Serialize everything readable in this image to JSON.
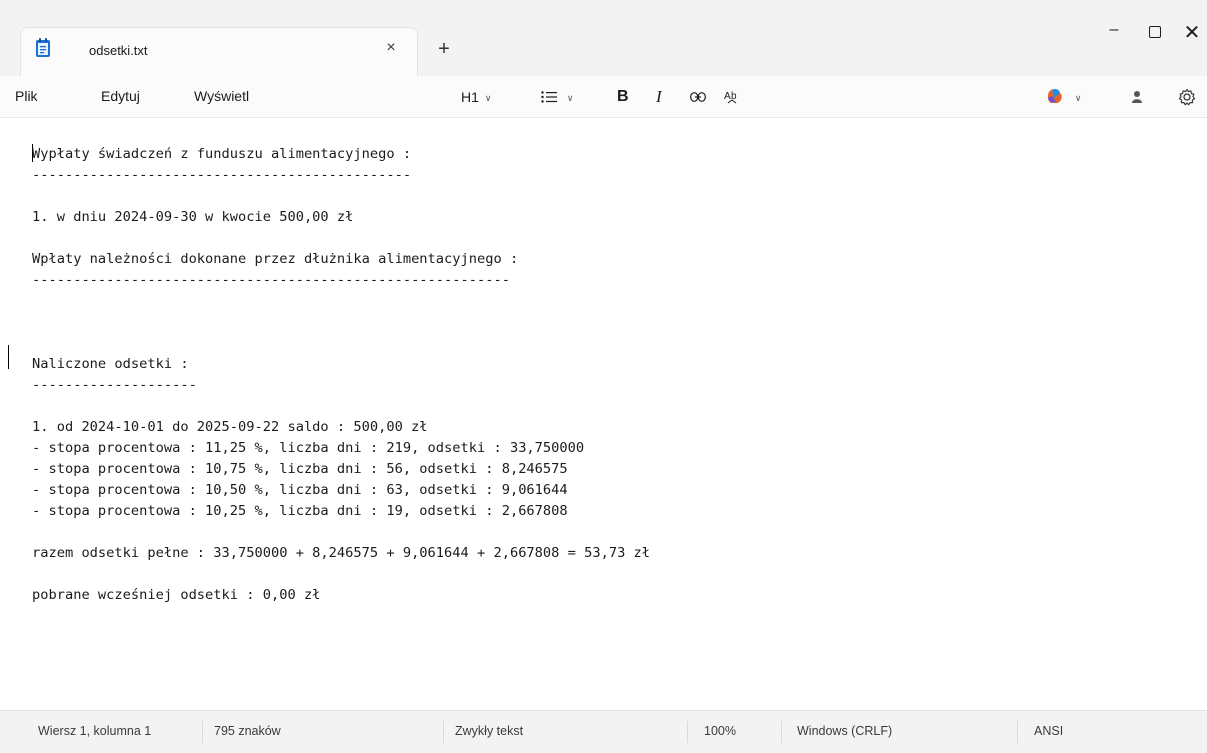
{
  "window": {
    "tab_title": "odsetki.txt",
    "tab_close": "×",
    "new_tab": "+",
    "minimize": "–",
    "maximize": "☐",
    "close": "✕"
  },
  "menu": {
    "items": [
      "Plik",
      "Edytuj",
      "Wyświetl"
    ],
    "heading_label": "H1"
  },
  "icons": {
    "app": "notepad-icon",
    "list": "bulleted-list-icon",
    "bold": "bold-icon",
    "italic": "italic-icon",
    "link": "link-icon",
    "spell": "spellcheck-icon",
    "copilot": "copilot-icon",
    "account": "account-icon",
    "settings": "gear-icon"
  },
  "toolbar": {
    "bold_label": "B",
    "italic_label": "I"
  },
  "document": {
    "lines": [
      "Wypłaty świadczeń z funduszu alimentacyjnego :",
      "----------------------------------------------",
      "",
      "1. w dniu 2024-09-30 w kwocie 500,00 zł",
      "",
      "Wpłaty należności dokonane przez dłużnika alimentacyjnego :",
      "----------------------------------------------------------",
      "",
      "",
      "",
      "Naliczone odsetki :",
      "--------------------",
      "",
      "1. od 2024-10-01 do 2025-09-22 saldo : 500,00 zł",
      "- stopa procentowa : 11,25 %, liczba dni : 219, odsetki : 33,750000",
      "- stopa procentowa : 10,75 %, liczba dni : 56, odsetki : 8,246575",
      "- stopa procentowa : 10,50 %, liczba dni : 63, odsetki : 9,061644",
      "- stopa procentowa : 10,25 %, liczba dni : 19, odsetki : 2,667808",
      "",
      "razem odsetki pełne : 33,750000 + 8,246575 + 9,061644 + 2,667808 = 53,73 zł",
      "",
      "pobrane wcześniej odsetki : 0,00 zł"
    ]
  },
  "status": {
    "position": "Wiersz 1, kolumna 1",
    "chars": "795 znaków",
    "format": "Zwykły tekst",
    "zoom": "100%",
    "line_endings": "Windows (CRLF)",
    "encoding": "ANSI"
  },
  "colors": {
    "titlebar_bg": "#f3f3f3",
    "editor_bg": "#ffffff",
    "notepad_icon_blue": "#1f6fd0",
    "copilot_accent": "#e8632b"
  }
}
